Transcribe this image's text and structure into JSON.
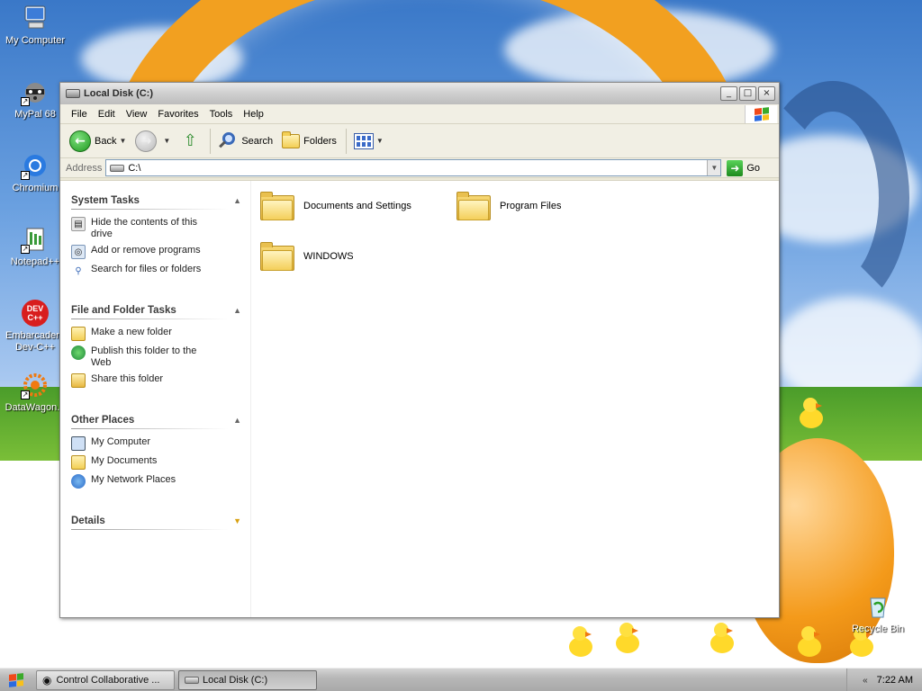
{
  "desktop": {
    "icons": [
      {
        "label": "My Computer"
      },
      {
        "label": "MyPal 68"
      },
      {
        "label": "Chromium"
      },
      {
        "label": "Notepad++"
      },
      {
        "label": "Embarcadero Dev-C++"
      },
      {
        "label": "DataWagon..."
      },
      {
        "label": "Recycle Bin"
      }
    ],
    "devcpp_badge": "DEV C++"
  },
  "window": {
    "title": "Local Disk (C:)",
    "buttons": {
      "minimize": "_",
      "maximize": "□",
      "close": "×"
    }
  },
  "menu": {
    "items": [
      "File",
      "Edit",
      "View",
      "Favorites",
      "Tools",
      "Help"
    ]
  },
  "toolbar": {
    "back": "Back",
    "search": "Search",
    "folders": "Folders"
  },
  "address": {
    "label": "Address",
    "value": "C:\\",
    "go": "Go"
  },
  "tasks": {
    "system": {
      "title": "System Tasks",
      "items": [
        "Hide the contents of this drive",
        "Add or remove programs",
        "Search for files or folders"
      ]
    },
    "file_folder": {
      "title": "File and Folder Tasks",
      "items": [
        "Make a new folder",
        "Publish this folder to the Web",
        "Share this folder"
      ]
    },
    "other": {
      "title": "Other Places",
      "items": [
        "My Computer",
        "My Documents",
        "My Network Places"
      ]
    },
    "details": {
      "title": "Details"
    }
  },
  "files": [
    {
      "name": "Documents and Settings"
    },
    {
      "name": "Program Files"
    },
    {
      "name": "WINDOWS"
    }
  ],
  "taskbar": {
    "items": [
      "Control Collaborative ...",
      "Local Disk (C:)"
    ],
    "clock": "7:22 AM"
  }
}
